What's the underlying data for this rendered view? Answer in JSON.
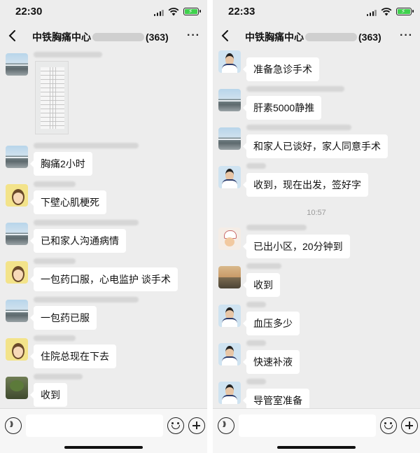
{
  "left_phone": {
    "status_time": "22:30",
    "title": "中铁胸痛中心",
    "member_count": "(363)",
    "messages": [
      {
        "avatar": "road-avatar",
        "text": ""
      },
      {
        "avatar": "road-avatar",
        "text": "胸痛2小时"
      },
      {
        "avatar": "cartoon-avatar",
        "text": "下壁心肌梗死"
      },
      {
        "avatar": "road-avatar",
        "text": "已和家人沟通病情"
      },
      {
        "avatar": "cartoon-avatar",
        "text": "一包药口服，心电监护 谈手术"
      },
      {
        "avatar": "road-avatar",
        "text": "一包药已服"
      },
      {
        "avatar": "cartoon-avatar",
        "text": "住院总现在下去"
      },
      {
        "avatar": "plant-avatar",
        "text": "收到"
      }
    ]
  },
  "right_phone": {
    "status_time": "22:33",
    "title": "中铁胸痛中心",
    "member_count": "(363)",
    "timestamp": "10:57",
    "messages": [
      {
        "avatar": "doctor-avatar",
        "text": "准备急诊手术"
      },
      {
        "avatar": "road-avatar",
        "text": "肝素5000静推"
      },
      {
        "avatar": "road-avatar",
        "text": "和家人已谈好，家人同意手术"
      },
      {
        "avatar": "doctor-avatar",
        "text": "收到，现在出发，签好字"
      },
      {
        "avatar": "cook-avatar",
        "text": "已出小区，20分钟到"
      },
      {
        "avatar": "sunset-avatar",
        "text": "收到"
      },
      {
        "avatar": "doctor-avatar",
        "text": "血压多少"
      },
      {
        "avatar": "doctor-avatar",
        "text": "快速补液"
      },
      {
        "avatar": "doctor-avatar",
        "text": "导管室准备"
      }
    ]
  },
  "colors": {
    "chat_background": "#ededed",
    "bubble": "#ffffff",
    "battery": "#3fd14d"
  }
}
